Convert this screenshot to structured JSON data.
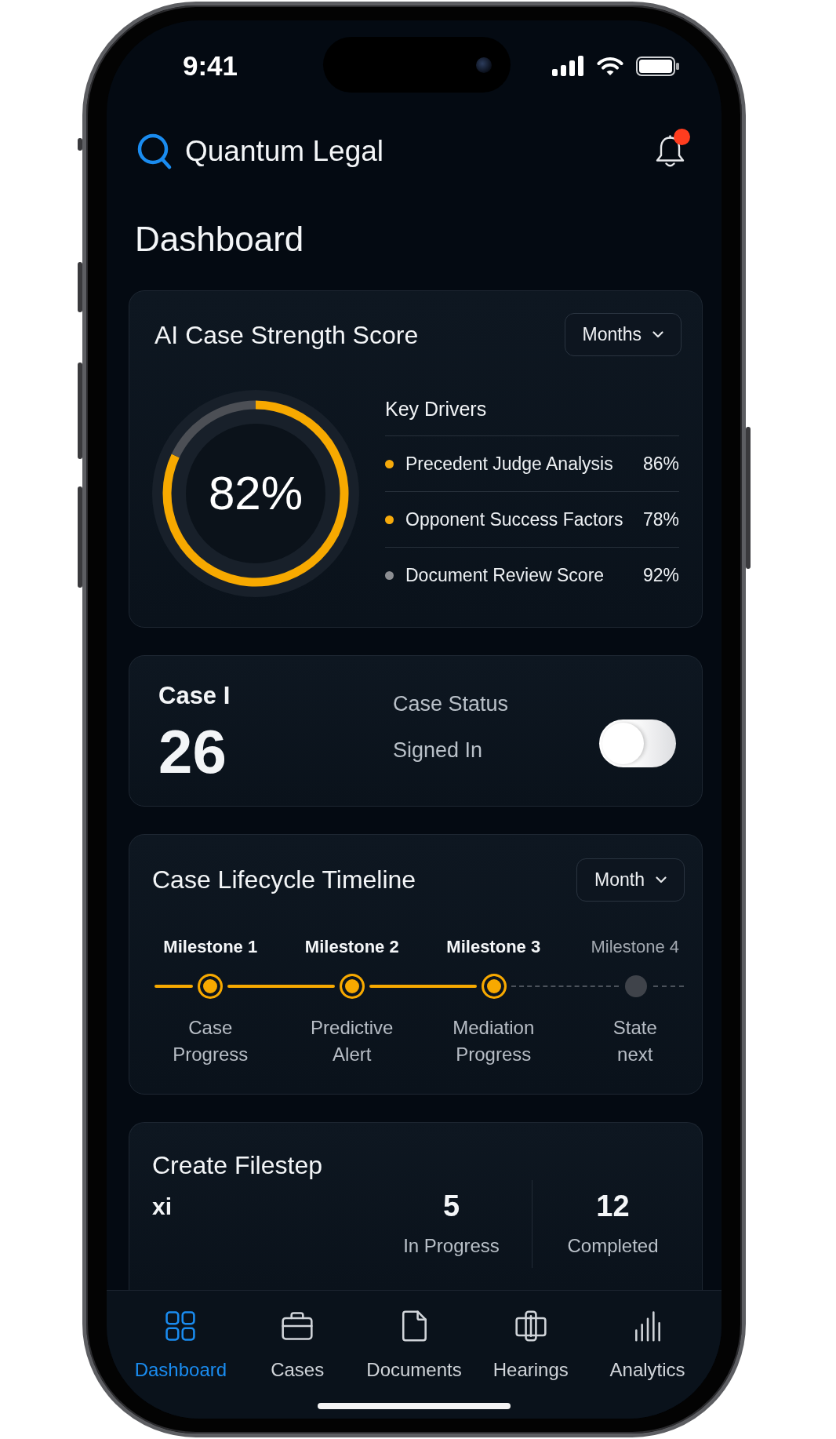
{
  "status_bar": {
    "time": "9:41"
  },
  "header": {
    "app_name": "Quantum Legal",
    "has_notification": true
  },
  "page_title": "Dashboard",
  "score_card": {
    "title": "AI Case Strength Score",
    "period_dropdown": "Months",
    "score_text": "82%",
    "chart_data": {
      "type": "donut",
      "values": [
        82,
        18
      ]
    },
    "key_drivers_title": "Key Drivers",
    "drivers": [
      {
        "name": "Precedent Judge Analysis",
        "value": "86%",
        "color": "#f6aa0b"
      },
      {
        "name": "Opponent Success Factors",
        "value": "78%",
        "color": "#f6aa0b"
      },
      {
        "name": "Document Review Score",
        "value": "92%",
        "color": "#8c8e92"
      }
    ]
  },
  "case_card": {
    "label": "Case I",
    "count": "26",
    "status_label": "Case Status",
    "status_value": "Signed In",
    "toggle_on": false
  },
  "timeline_card": {
    "title": "Case Lifecycle Timeline",
    "period_dropdown": "Month",
    "milestones": [
      {
        "label": "Milestone 1",
        "caption": "Case Progress",
        "completed": true
      },
      {
        "label": "Milestone 2",
        "caption": "Predictive Alert",
        "completed": true
      },
      {
        "label": "Milestone 3",
        "caption": "Mediation Progress",
        "completed": true
      },
      {
        "label": "Milestone 4",
        "caption": "State next",
        "completed": false
      }
    ]
  },
  "filestep_card": {
    "title": "Create Filestep",
    "subtitle": "xi",
    "stats": [
      {
        "value": "5",
        "label": "In Progress"
      },
      {
        "value": "12",
        "label": "Completed"
      }
    ]
  },
  "tab_bar": [
    {
      "label": "Dashboard",
      "selected": true
    },
    {
      "label": "Cases",
      "selected": false
    },
    {
      "label": "Documents",
      "selected": false
    },
    {
      "label": "Hearings",
      "selected": false
    },
    {
      "label": "Analytics",
      "selected": false
    }
  ]
}
